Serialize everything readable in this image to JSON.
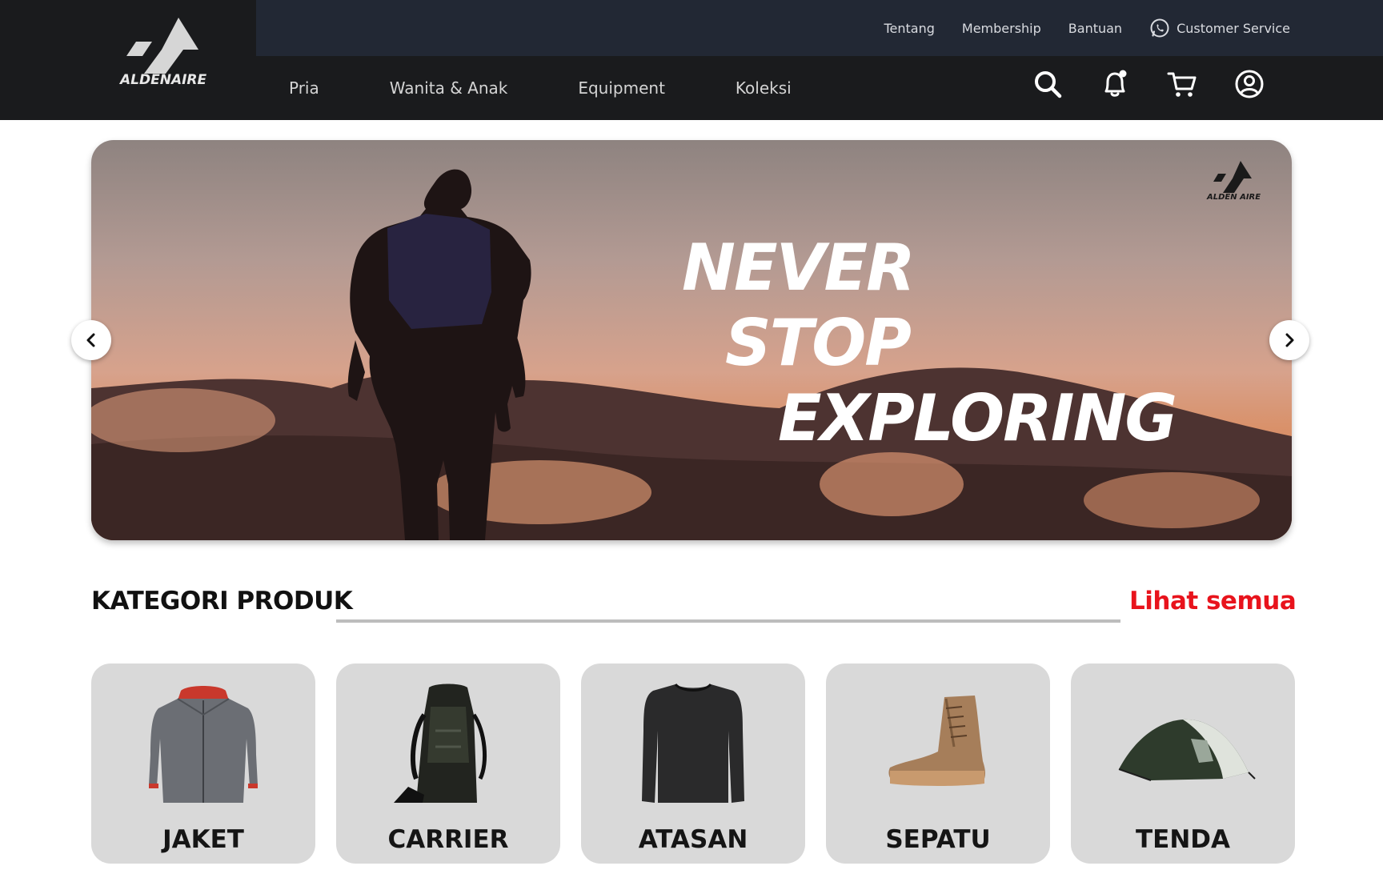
{
  "brand": {
    "name": "ALDENAIRE"
  },
  "topbar": {
    "links": [
      "Tentang",
      "Membership",
      "Bantuan"
    ],
    "customer_service": "Customer Service",
    "customer_service_icon": "whatsapp-icon"
  },
  "nav": {
    "items": [
      "Pria",
      "Wanita & Anak",
      "Equipment",
      "Koleksi"
    ],
    "icons": [
      "search-icon",
      "notification-bell-icon",
      "cart-icon",
      "user-account-icon"
    ]
  },
  "hero": {
    "line1": "NEVER",
    "line2": "STOP",
    "line3": "EXPLORING",
    "logo_text": "ALDEN AIRE",
    "prev_icon": "chevron-left-icon",
    "next_icon": "chevron-right-icon"
  },
  "category": {
    "title": "KATEGORI PRODUK",
    "see_all": "Lihat semua",
    "cards": [
      {
        "label": "JAKET",
        "icon": "jacket-icon"
      },
      {
        "label": "CARRIER",
        "icon": "backpack-icon"
      },
      {
        "label": "ATASAN",
        "icon": "shirt-icon"
      },
      {
        "label": "SEPATU",
        "icon": "boot-icon"
      },
      {
        "label": "TENDA",
        "icon": "tent-icon"
      }
    ]
  },
  "colors": {
    "header_bg": "#1a1b1d",
    "topbar_bg": "#222834",
    "accent_red": "#e8131c",
    "card_bg": "#d9d9d9"
  }
}
